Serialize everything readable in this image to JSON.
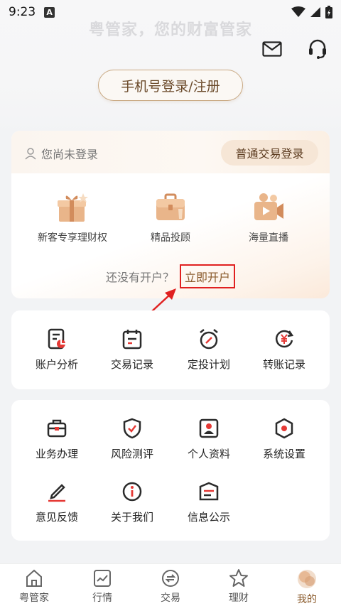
{
  "status_bar": {
    "time": "9:23",
    "notification_badge": "A"
  },
  "header": {
    "slogan": "粤管家，您的财富管家",
    "login_register_label": "手机号登录/注册"
  },
  "account_card": {
    "user_status": "您尚未登录",
    "normal_login_label": "普通交易登录",
    "features": [
      {
        "label": "新客专享理财权",
        "icon": "gift-icon"
      },
      {
        "label": "精品投顾",
        "icon": "briefcase-icon"
      },
      {
        "label": "海量直播",
        "icon": "video-camera-icon"
      }
    ],
    "open_prompt": "还没有开户？",
    "open_link": "立即开户"
  },
  "tools": [
    {
      "label": "账户分析",
      "icon": "account-analysis-icon"
    },
    {
      "label": "交易记录",
      "icon": "calendar-icon"
    },
    {
      "label": "定投计划",
      "icon": "alarm-clock-icon"
    },
    {
      "label": "转账记录",
      "icon": "transfer-yen-icon"
    }
  ],
  "services": [
    {
      "label": "业务办理",
      "icon": "toolbox-icon"
    },
    {
      "label": "风险测评",
      "icon": "shield-check-icon"
    },
    {
      "label": "个人资料",
      "icon": "profile-card-icon"
    },
    {
      "label": "系统设置",
      "icon": "settings-icon"
    },
    {
      "label": "意见反馈",
      "icon": "pen-icon"
    },
    {
      "label": "关于我们",
      "icon": "info-icon"
    },
    {
      "label": "信息公示",
      "icon": "notice-icon"
    }
  ],
  "bottom_nav": [
    {
      "label": "粤管家",
      "icon": "home-icon"
    },
    {
      "label": "行情",
      "icon": "market-chart-icon"
    },
    {
      "label": "交易",
      "icon": "trade-exchange-icon"
    },
    {
      "label": "理财",
      "icon": "star-icon"
    },
    {
      "label": "我的",
      "icon": "avatar-icon",
      "active": true
    }
  ],
  "colors": {
    "accent": "#8a5a2b",
    "annotation_red": "#e02020",
    "icon_dark": "#2b2b2b",
    "icon_red": "#e53935"
  }
}
